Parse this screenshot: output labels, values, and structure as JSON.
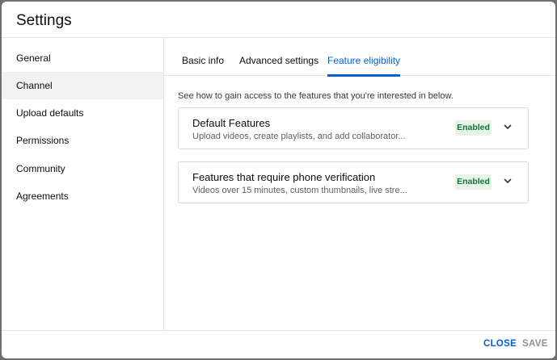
{
  "dialog": {
    "title": "Settings"
  },
  "sidebar": {
    "items": [
      {
        "label": "General",
        "active": false
      },
      {
        "label": "Channel",
        "active": true
      },
      {
        "label": "Upload defaults",
        "active": false
      },
      {
        "label": "Permissions",
        "active": false
      },
      {
        "label": "Community",
        "active": false
      },
      {
        "label": "Agreements",
        "active": false
      }
    ]
  },
  "tabs": [
    {
      "label": "Basic info",
      "active": false
    },
    {
      "label": "Advanced settings",
      "active": false
    },
    {
      "label": "Feature eligibility",
      "active": true
    }
  ],
  "main": {
    "intro": "See how to gain access to the features that you're interested in below.",
    "cards": [
      {
        "title": "Default Features",
        "description": "Upload videos, create playlists, and add collaborator...",
        "status": "Enabled",
        "icon": "chevron-down-icon"
      },
      {
        "title": "Features that require phone verification",
        "description": "Videos over 15 minutes, custom thumbnails, live stre...",
        "status": "Enabled",
        "icon": "chevron-down-icon"
      }
    ]
  },
  "footer": {
    "close_label": "CLOSE",
    "save_label": "SAVE"
  },
  "colors": {
    "accent": "#065fd4",
    "enabled_bg": "#e6f4ea",
    "enabled_text": "#137333",
    "disabled_text": "#909090"
  }
}
